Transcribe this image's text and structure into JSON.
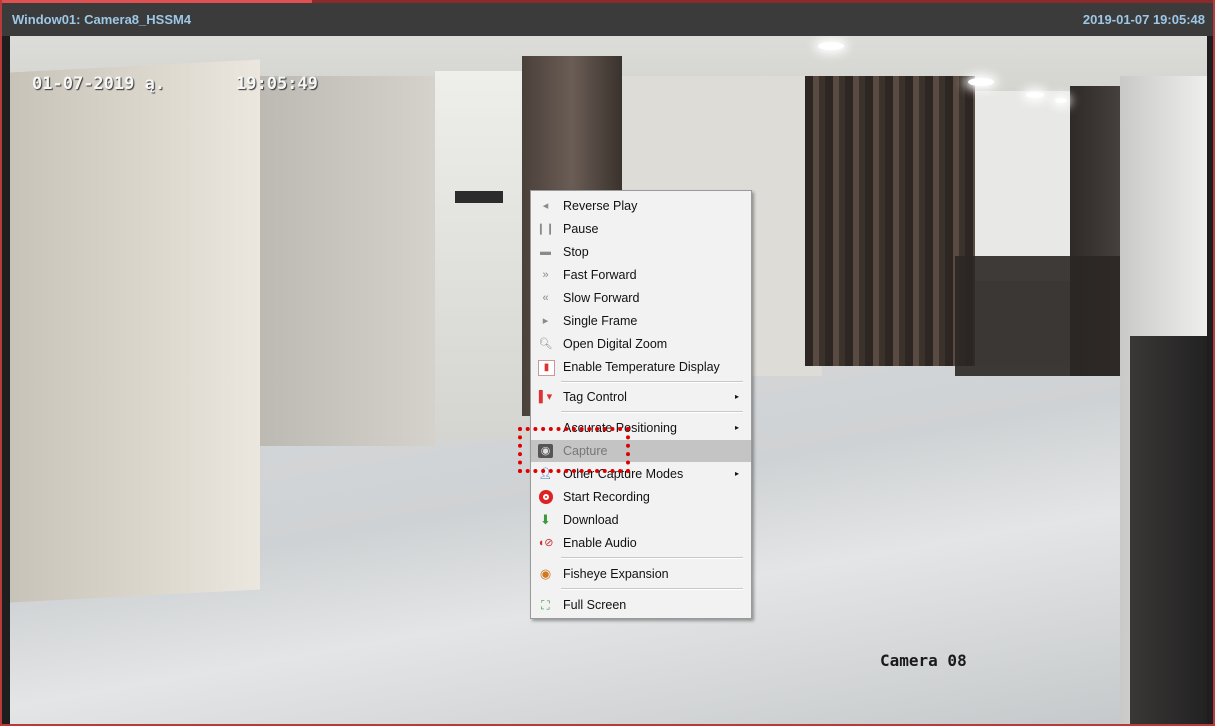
{
  "window": {
    "title": "Window01: Camera8_HSSM4",
    "timestamp": "2019-01-07 19:05:48"
  },
  "video": {
    "osd_date": "01-07-2019 ą.",
    "osd_time": "19:05:49",
    "osd_camera": "Camera 08"
  },
  "menu": {
    "items": [
      {
        "label": "Reverse Play",
        "icon": "reverse-play-icon"
      },
      {
        "label": "Pause",
        "icon": "pause-icon"
      },
      {
        "label": "Stop",
        "icon": "stop-icon"
      },
      {
        "label": "Fast Forward",
        "icon": "fast-forward-icon"
      },
      {
        "label": "Slow Forward",
        "icon": "slow-forward-icon"
      },
      {
        "label": "Single Frame",
        "icon": "single-frame-icon"
      },
      {
        "label": "Open Digital Zoom",
        "icon": "zoom-icon"
      },
      {
        "label": "Enable Temperature Display",
        "icon": "thermometer-icon"
      },
      {
        "label": "Tag Control",
        "icon": "tag-icon",
        "submenu": true
      },
      {
        "label": "Accurate Positioning",
        "icon": "positioning-icon",
        "submenu": true
      },
      {
        "label": "Capture",
        "icon": "camera-icon",
        "highlighted": true
      },
      {
        "label": "Other Capture Modes",
        "icon": "capture-modes-icon",
        "submenu": true
      },
      {
        "label": "Start Recording",
        "icon": "record-icon"
      },
      {
        "label": "Download",
        "icon": "download-icon"
      },
      {
        "label": "Enable Audio",
        "icon": "audio-icon"
      },
      {
        "label": "Fisheye Expansion",
        "icon": "fisheye-icon"
      },
      {
        "label": "Full Screen",
        "icon": "fullscreen-icon"
      }
    ],
    "submenu_arrow": "▸"
  },
  "colors": {
    "highlight_box": "#e00000",
    "title_text": "#9ec7e6",
    "menu_highlight": "#c4c4c4"
  }
}
